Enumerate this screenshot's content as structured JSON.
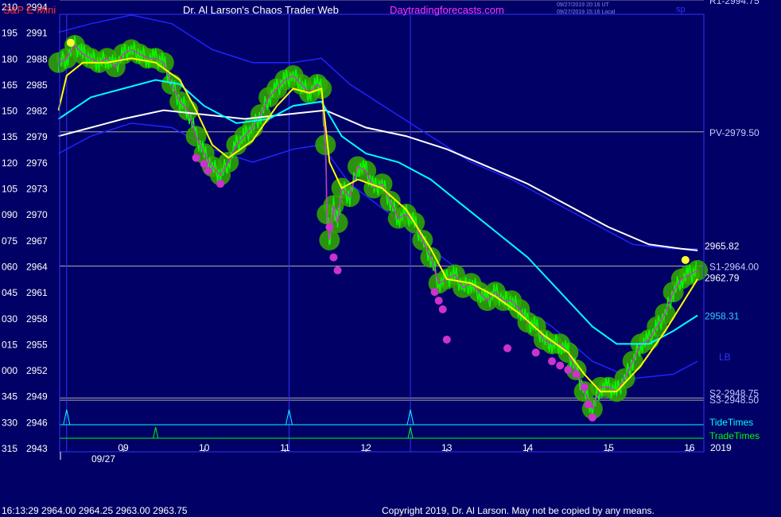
{
  "header": {
    "symbol": "S&P E-Mini",
    "title": "Dr. Al Larson's Chaos Trader Web",
    "site": "Daytradingforecasts.com",
    "stamp_utc": "09/27/2019 20:16 UT",
    "stamp_local": "09/27/2019 15:16 Local",
    "corner_label": "sp",
    "r1_label": "R1-2994.75"
  },
  "footer": {
    "quote": "16:13:29  2964.00 2964.25 2963.00 2963.75",
    "copyright": "Copyright 2019, Dr. Al Larson. May not be copied by any means."
  },
  "colors": {
    "background": "#000066",
    "price": "#00ff00",
    "ema_short": "#ffff00",
    "ema_mid": "#00ffff",
    "ema_long": "#ffffff",
    "band": "#2222ff",
    "tide_times": "#00ffff",
    "trade_times": "#00ff00",
    "magenta": "#cc33cc",
    "right_labels": "#c8c8ff"
  },
  "chart_data": {
    "type": "line",
    "title": "S&P E-Mini",
    "ylim": [
      2943,
      2994.75
    ],
    "y_ticks": [
      {
        "code": "210",
        "price": "2994",
        "v": 2994
      },
      {
        "code": "195",
        "price": "2991",
        "v": 2991
      },
      {
        "code": "180",
        "price": "2988",
        "v": 2988
      },
      {
        "code": "165",
        "price": "2985",
        "v": 2985
      },
      {
        "code": "150",
        "price": "2982",
        "v": 2982
      },
      {
        "code": "135",
        "price": "2979",
        "v": 2979
      },
      {
        "code": "120",
        "price": "2976",
        "v": 2976
      },
      {
        "code": "105",
        "price": "2973",
        "v": 2973
      },
      {
        "code": "090",
        "price": "2970",
        "v": 2970
      },
      {
        "code": "075",
        "price": "2967",
        "v": 2967
      },
      {
        "code": "060",
        "price": "2964",
        "v": 2964
      },
      {
        "code": "045",
        "price": "2961",
        "v": 2961
      },
      {
        "code": "030",
        "price": "2958",
        "v": 2958
      },
      {
        "code": "015",
        "price": "2955",
        "v": 2955
      },
      {
        "code": "000",
        "price": "2952",
        "v": 2952
      },
      {
        "code": "345",
        "price": "2949",
        "v": 2949
      },
      {
        "code": "330",
        "price": "2946",
        "v": 2946
      },
      {
        "code": "315",
        "price": "2943",
        "v": 2943
      }
    ],
    "x_ticks": [
      "09",
      "10",
      "11",
      "12",
      "13",
      "14",
      "15",
      "16"
    ],
    "x_tick_hours": [
      9,
      10,
      11,
      12,
      13,
      14,
      15,
      16
    ],
    "date_label": "09/27",
    "year_label": "2019",
    "xlim": [
      8.2,
      16.1
    ],
    "series": [
      {
        "key": "price",
        "values": [
          [
            8.2,
            2987.5
          ],
          [
            8.3,
            2988
          ],
          [
            8.4,
            2989.5
          ],
          [
            8.5,
            2988.5
          ],
          [
            8.6,
            2988
          ],
          [
            8.7,
            2987.5
          ],
          [
            8.8,
            2988
          ],
          [
            8.9,
            2987
          ],
          [
            9.0,
            2988.5
          ],
          [
            9.1,
            2989
          ],
          [
            9.2,
            2988.5
          ],
          [
            9.3,
            2988
          ],
          [
            9.4,
            2988
          ],
          [
            9.5,
            2987.5
          ],
          [
            9.6,
            2985
          ],
          [
            9.7,
            2983
          ],
          [
            9.8,
            2982
          ],
          [
            9.9,
            2979
          ],
          [
            10.0,
            2977
          ],
          [
            10.1,
            2975.5
          ],
          [
            10.2,
            2974.5
          ],
          [
            10.3,
            2976
          ],
          [
            10.4,
            2978
          ],
          [
            10.5,
            2979
          ],
          [
            10.6,
            2980
          ],
          [
            10.7,
            2981.5
          ],
          [
            10.8,
            2983.5
          ],
          [
            10.9,
            2984.5
          ],
          [
            11.0,
            2985.5
          ],
          [
            11.1,
            2986
          ],
          [
            11.2,
            2985
          ],
          [
            11.3,
            2984
          ],
          [
            11.4,
            2985
          ],
          [
            11.45,
            2984.5
          ],
          [
            11.5,
            2978
          ],
          [
            11.52,
            2970
          ],
          [
            11.55,
            2967
          ],
          [
            11.6,
            2971
          ],
          [
            11.65,
            2969
          ],
          [
            11.7,
            2973
          ],
          [
            11.8,
            2972
          ],
          [
            11.9,
            2975.5
          ],
          [
            12.0,
            2975
          ],
          [
            12.1,
            2973
          ],
          [
            12.2,
            2973.5
          ],
          [
            12.3,
            2971.5
          ],
          [
            12.4,
            2969.5
          ],
          [
            12.5,
            2970
          ],
          [
            12.6,
            2969
          ],
          [
            12.7,
            2967
          ],
          [
            12.8,
            2965
          ],
          [
            12.9,
            2962
          ],
          [
            13.0,
            2962.5
          ],
          [
            13.1,
            2963
          ],
          [
            13.2,
            2961.5
          ],
          [
            13.3,
            2962
          ],
          [
            13.4,
            2961
          ],
          [
            13.5,
            2960
          ],
          [
            13.6,
            2961
          ],
          [
            13.7,
            2960
          ],
          [
            13.8,
            2960
          ],
          [
            13.9,
            2959
          ],
          [
            14.0,
            2957.5
          ],
          [
            14.1,
            2957
          ],
          [
            14.2,
            2955.5
          ],
          [
            14.3,
            2955
          ],
          [
            14.4,
            2955
          ],
          [
            14.5,
            2954
          ],
          [
            14.6,
            2952
          ],
          [
            14.7,
            2949.5
          ],
          [
            14.8,
            2947.5
          ],
          [
            14.9,
            2950
          ],
          [
            15.0,
            2950
          ],
          [
            15.1,
            2949.5
          ],
          [
            15.2,
            2951
          ],
          [
            15.3,
            2953
          ],
          [
            15.4,
            2955
          ],
          [
            15.5,
            2955.5
          ],
          [
            15.6,
            2957
          ],
          [
            15.7,
            2958.5
          ],
          [
            15.8,
            2961
          ],
          [
            15.9,
            2962.5
          ],
          [
            16.0,
            2963
          ],
          [
            16.1,
            2963.5
          ]
        ]
      },
      {
        "key": "ema_short",
        "values": [
          [
            8.2,
            2982
          ],
          [
            8.3,
            2986
          ],
          [
            8.5,
            2987.5
          ],
          [
            8.8,
            2987.5
          ],
          [
            9.1,
            2988
          ],
          [
            9.4,
            2987.5
          ],
          [
            9.7,
            2985.5
          ],
          [
            9.9,
            2982
          ],
          [
            10.1,
            2978
          ],
          [
            10.3,
            2976.5
          ],
          [
            10.6,
            2978.5
          ],
          [
            10.9,
            2982.5
          ],
          [
            11.1,
            2984.5
          ],
          [
            11.3,
            2984
          ],
          [
            11.45,
            2984.5
          ],
          [
            11.55,
            2976
          ],
          [
            11.7,
            2973
          ],
          [
            11.9,
            2974
          ],
          [
            12.2,
            2973
          ],
          [
            12.5,
            2970.5
          ],
          [
            12.8,
            2966
          ],
          [
            13.0,
            2962.5
          ],
          [
            13.3,
            2962
          ],
          [
            13.6,
            2960.5
          ],
          [
            13.9,
            2958.5
          ],
          [
            14.2,
            2956
          ],
          [
            14.5,
            2954
          ],
          [
            14.7,
            2951.5
          ],
          [
            14.9,
            2949.5
          ],
          [
            15.1,
            2949.5
          ],
          [
            15.4,
            2952.5
          ],
          [
            15.7,
            2956.5
          ],
          [
            16.0,
            2961
          ],
          [
            16.1,
            2962.5
          ]
        ]
      },
      {
        "key": "ema_mid",
        "values": [
          [
            8.2,
            2981
          ],
          [
            8.6,
            2983.5
          ],
          [
            9.0,
            2984.5
          ],
          [
            9.4,
            2985.5
          ],
          [
            9.7,
            2985
          ],
          [
            10.0,
            2982.5
          ],
          [
            10.4,
            2980.5
          ],
          [
            10.8,
            2981
          ],
          [
            11.1,
            2982.5
          ],
          [
            11.45,
            2983
          ],
          [
            11.7,
            2979
          ],
          [
            12.0,
            2977
          ],
          [
            12.4,
            2976
          ],
          [
            12.8,
            2974
          ],
          [
            13.2,
            2971
          ],
          [
            13.6,
            2968
          ],
          [
            14.0,
            2965
          ],
          [
            14.4,
            2961
          ],
          [
            14.8,
            2957
          ],
          [
            15.1,
            2955
          ],
          [
            15.5,
            2955
          ],
          [
            15.8,
            2956.5
          ],
          [
            16.1,
            2958.3
          ]
        ]
      },
      {
        "key": "ema_long",
        "values": [
          [
            8.2,
            2979
          ],
          [
            8.6,
            2980
          ],
          [
            9.0,
            2981
          ],
          [
            9.5,
            2982
          ],
          [
            10.0,
            2981.5
          ],
          [
            10.5,
            2981
          ],
          [
            11.0,
            2981.5
          ],
          [
            11.5,
            2982
          ],
          [
            12.0,
            2980
          ],
          [
            12.5,
            2979
          ],
          [
            13.0,
            2977.5
          ],
          [
            13.5,
            2975.5
          ],
          [
            14.0,
            2973.5
          ],
          [
            14.5,
            2971
          ],
          [
            15.0,
            2968.5
          ],
          [
            15.5,
            2966.5
          ],
          [
            15.9,
            2966
          ],
          [
            16.1,
            2965.8
          ]
        ]
      },
      {
        "key": "band_upper",
        "values": [
          [
            8.2,
            2991
          ],
          [
            8.6,
            2992
          ],
          [
            9.1,
            2993
          ],
          [
            9.6,
            2992
          ],
          [
            10.1,
            2989
          ],
          [
            10.6,
            2987.5
          ],
          [
            11.1,
            2987.5
          ],
          [
            11.45,
            2988
          ],
          [
            11.8,
            2985
          ],
          [
            12.3,
            2982
          ],
          [
            12.8,
            2979
          ],
          [
            13.3,
            2976
          ],
          [
            13.8,
            2974
          ],
          [
            14.3,
            2971.5
          ],
          [
            14.8,
            2969
          ],
          [
            15.3,
            2966.5
          ],
          [
            15.8,
            2966
          ],
          [
            16.1,
            2966
          ]
        ]
      },
      {
        "key": "band_lower",
        "values": [
          [
            8.2,
            2977
          ],
          [
            8.6,
            2979
          ],
          [
            9.1,
            2980.5
          ],
          [
            9.6,
            2980
          ],
          [
            10.1,
            2977.5
          ],
          [
            10.6,
            2976
          ],
          [
            11.1,
            2977.5
          ],
          [
            11.45,
            2978
          ],
          [
            11.8,
            2973.5
          ],
          [
            12.3,
            2970
          ],
          [
            12.8,
            2966
          ],
          [
            13.3,
            2962.5
          ],
          [
            13.8,
            2960
          ],
          [
            14.3,
            2957
          ],
          [
            14.8,
            2953
          ],
          [
            15.3,
            2951
          ],
          [
            15.8,
            2951.5
          ],
          [
            16.1,
            2953
          ]
        ]
      }
    ],
    "horizontal_levels": [
      {
        "label": "R1-2994.75",
        "v": 2994.75
      },
      {
        "label": "PV-2979.50",
        "v": 2979.5
      },
      {
        "label": "S1-2964.00",
        "v": 2964
      },
      {
        "label": "S2-2948.75",
        "v": 2948.75
      },
      {
        "label": "S3-2948.50",
        "v": 2948.5
      }
    ],
    "last_values": [
      {
        "label": "2965.82",
        "v": 2965.82
      },
      {
        "label": "2962.79",
        "v": 2962.79
      },
      {
        "label": "2958.31",
        "v": 2958.31
      }
    ],
    "lb_label": "LB",
    "vertical_markers": [
      8.3,
      11.05,
      12.55
    ],
    "magenta_dots": [
      [
        9.9,
        2976.5
      ],
      [
        10.0,
        2975.8
      ],
      [
        10.05,
        2975
      ],
      [
        10.2,
        2973.5
      ],
      [
        11.55,
        2968.5
      ],
      [
        11.6,
        2965
      ],
      [
        11.65,
        2963.5
      ],
      [
        12.85,
        2961
      ],
      [
        12.9,
        2960
      ],
      [
        12.95,
        2959
      ],
      [
        13.0,
        2955.5
      ],
      [
        13.75,
        2954.5
      ],
      [
        14.1,
        2954
      ],
      [
        14.3,
        2953
      ],
      [
        14.4,
        2952.5
      ],
      [
        14.5,
        2952
      ],
      [
        14.6,
        2951.5
      ],
      [
        14.7,
        2950
      ],
      [
        14.75,
        2948
      ],
      [
        14.8,
        2946.5
      ]
    ],
    "yellow_dots": [
      [
        8.35,
        2989.8
      ],
      [
        15.95,
        2964.7
      ]
    ],
    "tide_times": {
      "label": "TideTimes",
      "spikes": [
        8.3,
        11.05,
        12.55
      ]
    },
    "trade_times": {
      "label": "TradeTimes",
      "spikes": [
        9.4,
        12.55
      ]
    }
  }
}
